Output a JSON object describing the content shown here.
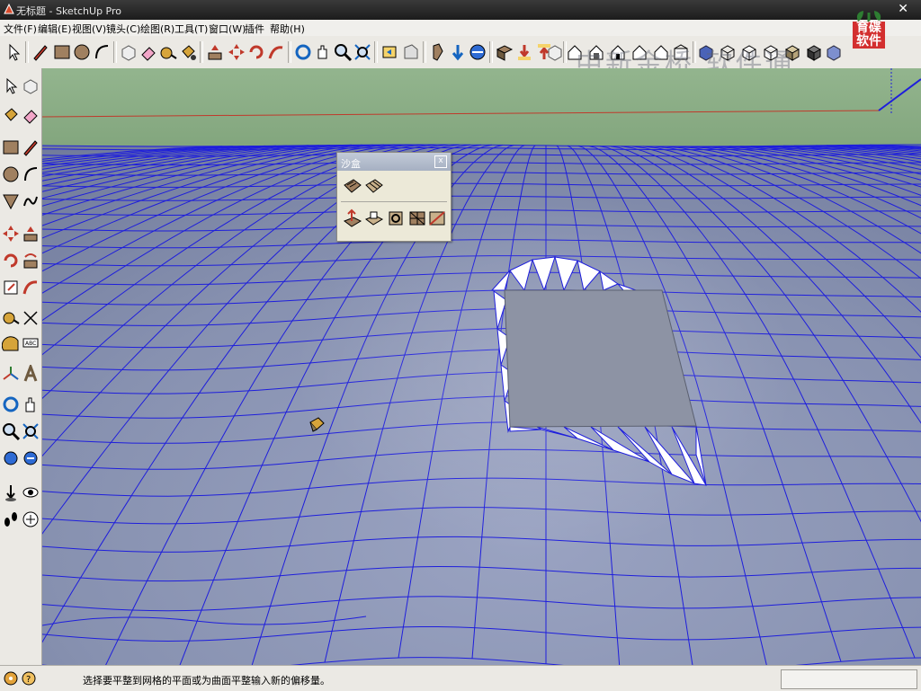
{
  "window": {
    "title": "无标题 - SketchUp Pro",
    "close_glyph": "✕"
  },
  "menu": [
    "文件(F)",
    "编辑(E)",
    "视图(V)",
    "镜头(C)",
    "绘图(R)",
    "工具(T)",
    "窗口(W)",
    "插件",
    "帮助(H)"
  ],
  "watermark": "中新金桥 软件通",
  "logo": {
    "line1": "育碟",
    "line2": "软件"
  },
  "sandbox_panel": {
    "title": "沙盒",
    "close_glyph": "x",
    "tools": [
      "from-contours-icon",
      "from-scratch-icon",
      "smoove-icon",
      "stamp-icon",
      "drape-icon",
      "add-detail-icon",
      "flip-edge-icon"
    ]
  },
  "status": {
    "message": "选择要平整到网格的平面或为曲面平整输入新的偏移量。"
  },
  "colors": {
    "sky": "#8fb08a",
    "ground": "#8a94b0",
    "grid": "#1e1edc",
    "red_axis": "#c0392b",
    "flat_top": "#8d93a4"
  },
  "top_toolbar_icons": [
    "select-icon",
    "pencil-icon",
    "rectangle-icon",
    "circle-icon",
    "arc-icon",
    "make-component-icon",
    "eraser-icon",
    "tape-measure-icon",
    "paint-bucket-icon",
    "push-pull-icon",
    "move-icon",
    "rotate-icon",
    "follow-me-icon",
    "orbit-icon",
    "pan-icon",
    "zoom-icon",
    "zoom-extents-icon",
    "previous-view-icon",
    "next-view-icon",
    "position-camera-icon",
    "walk-icon",
    "look-around-icon",
    "section-plane-icon",
    "get-models-icon",
    "share-model-icon",
    "share-component-icon",
    "iso-view-icon",
    "top-view-icon",
    "front-view-icon",
    "right-view-icon",
    "back-view-icon",
    "left-view-icon",
    "xray-icon",
    "wireframe-icon",
    "hidden-line-icon",
    "shaded-icon",
    "shaded-textures-icon",
    "monochrome-icon"
  ],
  "left_toolbar_icons": [
    "select-icon",
    "make-component-icon",
    "paint-bucket-icon",
    "eraser-icon",
    "rectangle-icon",
    "line-icon",
    "circle-icon",
    "arc-icon",
    "polygon-icon",
    "freehand-icon",
    "move-icon",
    "push-pull-icon",
    "rotate-icon",
    "follow-me-icon",
    "scale-icon",
    "offset-icon",
    "tape-measure-icon",
    "dimension-icon",
    "protractor-icon",
    "text-icon",
    "axes-icon",
    "3d-text-icon",
    "orbit-icon",
    "pan-icon",
    "zoom-icon",
    "zoom-window-icon",
    "previous-view-icon",
    "zoom-extents-icon",
    "position-camera-icon",
    "look-around-icon",
    "walk-icon",
    "section-plane-icon"
  ]
}
